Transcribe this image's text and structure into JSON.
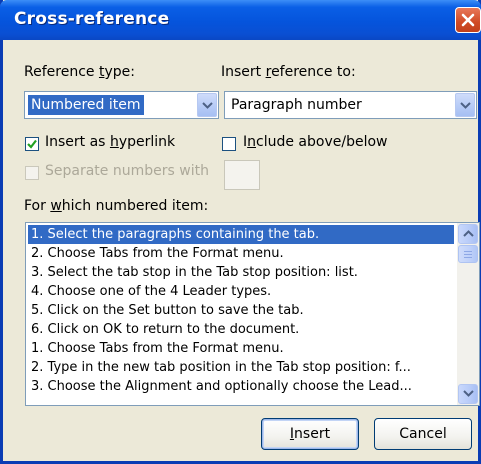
{
  "dialog": {
    "title": "Cross-reference",
    "reference_type": {
      "label": "Reference type:",
      "value": "Numbered item"
    },
    "insert_reference_to": {
      "label": "Insert reference to:",
      "value": "Paragraph number"
    },
    "insert_as_hyperlink": {
      "label": "Insert as hyperlink",
      "checked": true
    },
    "include_above_below": {
      "label": "Include above/below",
      "checked": false
    },
    "separate_numbers": {
      "label": "Separate numbers with",
      "checked": false,
      "enabled": false
    },
    "items_label": "For which numbered item:",
    "items": [
      "1. Select the paragraphs containing the tab.",
      "2. Choose Tabs from the Format menu.",
      "3. Select the tab stop in the Tab stop position: list.",
      "4. Choose one of the 4 Leader types.",
      "5. Click on the Set button to save the tab.",
      "6. Click on OK to return to the document.",
      "1. Choose Tabs from the Format menu.",
      "2. Type in the new tab position in the Tab stop position: f...",
      "3. Choose the Alignment and optionally choose the Lead..."
    ],
    "selected_item_index": 0,
    "buttons": {
      "insert": "Insert",
      "cancel": "Cancel"
    }
  },
  "colors": {
    "titlebar": "#0554dc",
    "dialog_bg": "#ece9d8",
    "selection": "#316ac5",
    "close_button": "#d04a25"
  }
}
